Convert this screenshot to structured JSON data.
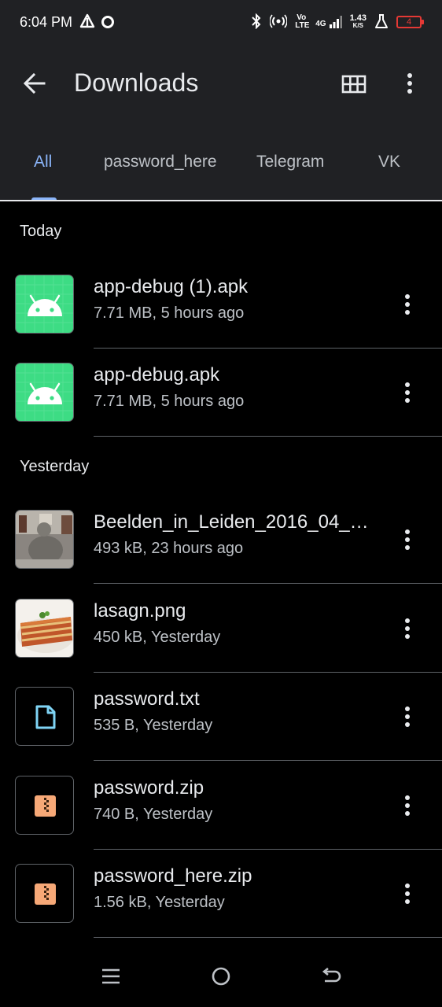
{
  "status_bar": {
    "time": "6:04 PM",
    "signal_label": "4G",
    "volte_label": "Vo LTE",
    "speed_value": "1.43",
    "speed_unit": "K/S",
    "battery_level": "4",
    "colors": {
      "battery_low": "#e53935"
    }
  },
  "app_bar": {
    "title": "Downloads",
    "icons": {
      "back": "arrow-back-icon",
      "view": "grid-view-icon",
      "more": "more-vert-icon"
    }
  },
  "tabs": [
    {
      "label": "All",
      "active": true
    },
    {
      "label": "password_here",
      "active": false
    },
    {
      "label": "Telegram",
      "active": false
    },
    {
      "label": "VK",
      "active": false
    }
  ],
  "sections": {
    "today": {
      "header": "Today",
      "files": [
        {
          "name": "app-debug (1).apk",
          "meta": "7.71 MB, 5 hours ago",
          "icon": "android-icon"
        },
        {
          "name": "app-debug.apk",
          "meta": "7.71 MB, 5 hours ago",
          "icon": "android-icon"
        }
      ]
    },
    "yesterday": {
      "header": "Yesterday",
      "files": [
        {
          "name": "Beelden_in_Leiden_2016_04_…",
          "meta": "493 kB, 23 hours ago",
          "icon": "image-thumbnail"
        },
        {
          "name": "lasagn.png",
          "meta": "450 kB, Yesterday",
          "icon": "image-thumbnail"
        },
        {
          "name": "password.txt",
          "meta": "535 B, Yesterday",
          "icon": "document-icon"
        },
        {
          "name": "password.zip",
          "meta": "740 B, Yesterday",
          "icon": "zip-icon"
        },
        {
          "name": "password_here.zip",
          "meta": "1.56 kB, Yesterday",
          "icon": "zip-icon"
        }
      ]
    }
  },
  "nav_bar": {
    "icons": [
      "menu-icon",
      "home-icon",
      "back-icon"
    ]
  },
  "colors": {
    "accent": "#8ab4f8",
    "topbar_bg": "#202124",
    "apk_green": "#3ddc84",
    "zip_orange": "#f6a877",
    "doc_blue": "#7fd4f5"
  }
}
